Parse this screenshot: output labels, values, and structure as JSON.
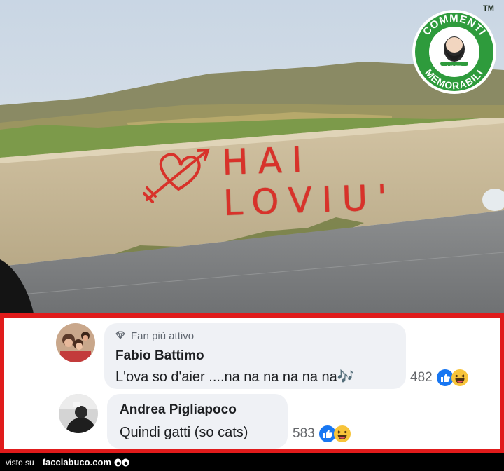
{
  "photo": {
    "graffiti_text": "HAI LOVIU'",
    "badge": {
      "top_text": "COMMENTI",
      "bottom_text": "MEMORABILI",
      "small_text": "MATI PER IGNORARE",
      "trademark": "TM",
      "color": "#2e9b3c"
    }
  },
  "comments": [
    {
      "badge_label": "Fan più attivo",
      "badge_icon": "diamond-icon",
      "author": "Fabio Battimo",
      "text": "L'ova so d'aier ....na na na na na na🎶",
      "reaction_count": "482",
      "reactions": [
        "like",
        "haha"
      ]
    },
    {
      "author": "Andrea Pigliapoco",
      "text": "Quindi gatti (so cats)",
      "reaction_count": "583",
      "reactions": [
        "like",
        "haha"
      ]
    }
  ],
  "footer": {
    "seen_on": "visto su",
    "site": "facciabuco.com"
  },
  "colors": {
    "frame_red": "#e01b1b",
    "bubble": "#eff1f5",
    "like_blue": "#1877f2",
    "haha_yellow": "#f7c43a"
  }
}
